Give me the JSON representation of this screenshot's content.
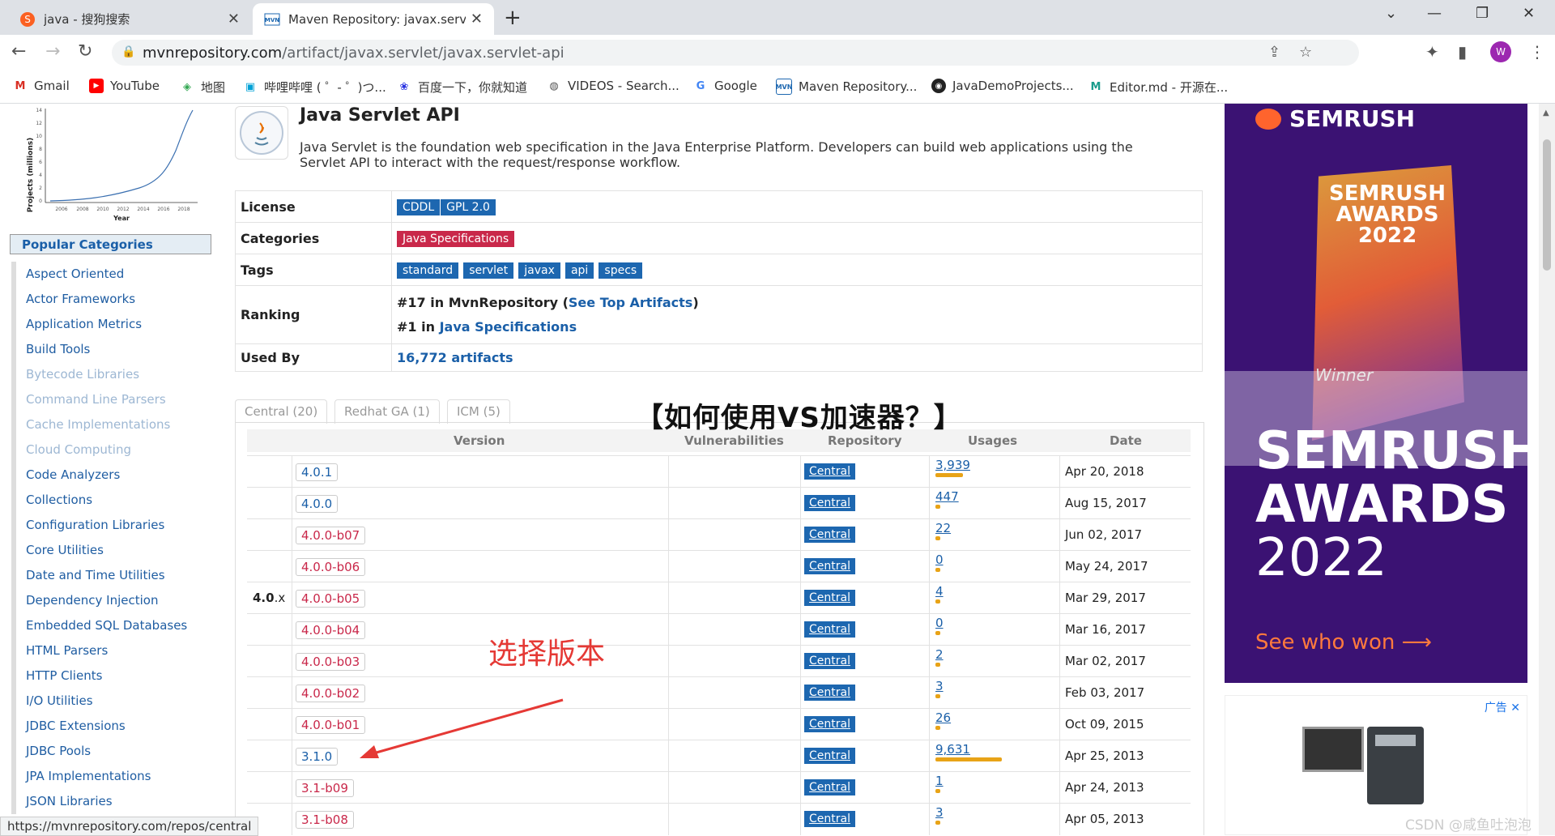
{
  "browser": {
    "tabs": [
      {
        "title": "java - 搜狗搜索",
        "favicon": "sogou-icon"
      },
      {
        "title": "Maven Repository: javax.servle",
        "favicon": "mvn-icon"
      }
    ],
    "url_domain": "mvnrepository.com",
    "url_path": "/artifact/javax.servlet/javax.servlet-api",
    "avatar": "W",
    "bookmarks": [
      "Gmail",
      "YouTube",
      "地图",
      "哔哩哔哩 ( ゜- ゜)つ...",
      "百度一下，你就知道",
      "VIDEOS - Search...",
      "Google",
      "Maven Repository...",
      "JavaDemoProjects...",
      "Editor.md - 开源在..."
    ]
  },
  "sidebar": {
    "chart": {
      "ylabel": "Projects (millions)",
      "xlabel": "Year",
      "yticks": [
        "14",
        "12",
        "10",
        "8",
        "6",
        "4",
        "2",
        "0"
      ],
      "xticks": [
        "2006",
        "2008",
        "2010",
        "2012",
        "2014",
        "2016",
        "2018"
      ]
    },
    "heading": "Popular Categories",
    "categories": [
      {
        "label": "Aspect Oriented",
        "dim": false
      },
      {
        "label": "Actor Frameworks",
        "dim": false
      },
      {
        "label": "Application Metrics",
        "dim": false
      },
      {
        "label": "Build Tools",
        "dim": false
      },
      {
        "label": "Bytecode Libraries",
        "dim": true
      },
      {
        "label": "Command Line Parsers",
        "dim": true
      },
      {
        "label": "Cache Implementations",
        "dim": true
      },
      {
        "label": "Cloud Computing",
        "dim": true
      },
      {
        "label": "Code Analyzers",
        "dim": false
      },
      {
        "label": "Collections",
        "dim": false
      },
      {
        "label": "Configuration Libraries",
        "dim": false
      },
      {
        "label": "Core Utilities",
        "dim": false
      },
      {
        "label": "Date and Time Utilities",
        "dim": false
      },
      {
        "label": "Dependency Injection",
        "dim": false
      },
      {
        "label": "Embedded SQL Databases",
        "dim": false
      },
      {
        "label": "HTML Parsers",
        "dim": false
      },
      {
        "label": "HTTP Clients",
        "dim": false
      },
      {
        "label": "I/O Utilities",
        "dim": false
      },
      {
        "label": "JDBC Extensions",
        "dim": false
      },
      {
        "label": "JDBC Pools",
        "dim": false
      },
      {
        "label": "JPA Implementations",
        "dim": false
      },
      {
        "label": "JSON Libraries",
        "dim": false
      }
    ]
  },
  "artifact": {
    "title": "Java Servlet API",
    "description": "Java Servlet is the foundation web specification in the Java Enterprise Platform. Developers can build web applications using the Servlet API to interact with the request/response workflow.",
    "license_label": "License",
    "licenses": [
      "CDDL",
      "GPL 2.0"
    ],
    "categories_label": "Categories",
    "categories": [
      "Java Specifications"
    ],
    "tags_label": "Tags",
    "tags": [
      "standard",
      "servlet",
      "javax",
      "api",
      "specs"
    ],
    "ranking_label": "Ranking",
    "rank1_prefix": "#17 in MvnRepository (",
    "rank1_link": "See Top Artifacts",
    "rank1_suffix": ")",
    "rank2_prefix": "#1 in ",
    "rank2_link": "Java Specifications",
    "usedby_label": "Used By",
    "usedby": "16,772 artifacts"
  },
  "versions": {
    "tabs": [
      "Central (20)",
      "Redhat GA (1)",
      "ICM (5)"
    ],
    "headers": [
      "Version",
      "Vulnerabilities",
      "Repository",
      "Usages",
      "Date"
    ],
    "major": "4.0",
    "major_suffix": ".x",
    "rows": [
      {
        "version": "4.0.1",
        "repo": "Central",
        "usages": "3,939",
        "usage_frac": 0.41,
        "date": "Apr 20, 2018",
        "beta": false
      },
      {
        "version": "4.0.0",
        "repo": "Central",
        "usages": "447",
        "usage_frac": 0.05,
        "date": "Aug 15, 2017",
        "beta": false
      },
      {
        "version": "4.0.0-b07",
        "repo": "Central",
        "usages": "22",
        "usage_frac": 0.01,
        "date": "Jun 02, 2017",
        "beta": true
      },
      {
        "version": "4.0.0-b06",
        "repo": "Central",
        "usages": "0",
        "usage_frac": 0.01,
        "date": "May 24, 2017",
        "beta": true
      },
      {
        "version": "4.0.0-b05",
        "repo": "Central",
        "usages": "4",
        "usage_frac": 0.01,
        "date": "Mar 29, 2017",
        "beta": true
      },
      {
        "version": "4.0.0-b04",
        "repo": "Central",
        "usages": "0",
        "usage_frac": 0.01,
        "date": "Mar 16, 2017",
        "beta": true
      },
      {
        "version": "4.0.0-b03",
        "repo": "Central",
        "usages": "2",
        "usage_frac": 0.01,
        "date": "Mar 02, 2017",
        "beta": true
      },
      {
        "version": "4.0.0-b02",
        "repo": "Central",
        "usages": "3",
        "usage_frac": 0.01,
        "date": "Feb 03, 2017",
        "beta": true
      },
      {
        "version": "4.0.0-b01",
        "repo": "Central",
        "usages": "26",
        "usage_frac": 0.01,
        "date": "Oct 09, 2015",
        "beta": true
      },
      {
        "version": "3.1.0",
        "repo": "Central",
        "usages": "9,631",
        "usage_frac": 1.0,
        "date": "Apr 25, 2013",
        "beta": false
      },
      {
        "version": "3.1-b09",
        "repo": "Central",
        "usages": "1",
        "usage_frac": 0.01,
        "date": "Apr 24, 2013",
        "beta": true
      },
      {
        "version": "3.1-b08",
        "repo": "Central",
        "usages": "3",
        "usage_frac": 0.01,
        "date": "Apr 05, 2013",
        "beta": true
      }
    ]
  },
  "overlay": {
    "title": "【如何使用VS加速器？】",
    "annotation": "选择版本"
  },
  "ads": {
    "brand": "SEMRUSH",
    "trophy_text": "SEMRUSH AWARDS 2022",
    "winner": "Winner",
    "line1": "SEMRUSH",
    "line2": "AWARDS",
    "line3": "2022",
    "cta": "See who won ⟶",
    "label2": "广告"
  },
  "status_url": "https://mvnrepository.com/repos/central",
  "watermark": "CSDN @咸鱼吐泡泡",
  "colors": {
    "link": "#1a5fa8",
    "badge": "#1d67b0",
    "badge_red": "#c9284a",
    "usage_bar": "#e8a317",
    "ad_bg": "#3b1273"
  }
}
